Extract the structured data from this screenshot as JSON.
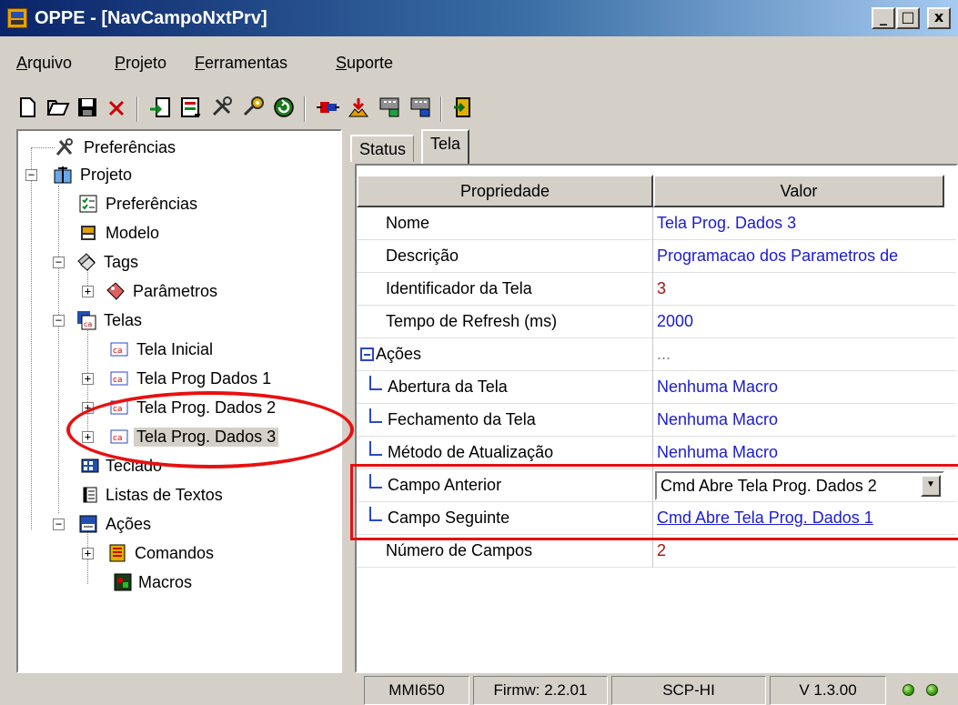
{
  "window": {
    "title": "OPPE - [NavCampoNxtPrv]",
    "buttons": {
      "minimize": "_",
      "maximize": "□",
      "close": "x"
    }
  },
  "menu": {
    "items": [
      {
        "first": "A",
        "rest": "rquivo"
      },
      {
        "first": "P",
        "rest": "rojeto"
      },
      {
        "first": "F",
        "rest": "erramentas"
      },
      {
        "first": "S",
        "rest": "uporte"
      }
    ]
  },
  "toolbar": {
    "icons": [
      "new-file-icon",
      "open-folder-icon",
      "save-icon",
      "delete-icon",
      "import-icon",
      "export-icon",
      "tools-icon",
      "settings-icon",
      "refresh-icon",
      "transfer-icon",
      "send-icon",
      "download-icon",
      "upload-icon",
      "exit-icon"
    ]
  },
  "tree": {
    "items": [
      {
        "label": "Preferências"
      },
      {
        "label": "Projeto"
      },
      {
        "label": "Preferências"
      },
      {
        "label": "Modelo"
      },
      {
        "label": "Tags"
      },
      {
        "label": "Parâmetros"
      },
      {
        "label": "Telas"
      },
      {
        "label": "Tela Inicial"
      },
      {
        "label": "Tela Prog Dados 1"
      },
      {
        "label": "Tela Prog. Dados 2"
      },
      {
        "label": "Tela Prog. Dados 3"
      },
      {
        "label": "Teclado"
      },
      {
        "label": "Listas de Textos"
      },
      {
        "label": "Ações"
      },
      {
        "label": "Comandos"
      },
      {
        "label": "Macros"
      }
    ]
  },
  "tabs": {
    "status": "Status",
    "tela": "Tela"
  },
  "grid": {
    "headers": {
      "prop": "Propriedade",
      "val": "Valor"
    },
    "rows": [
      {
        "prop": "Nome",
        "val": "Tela Prog. Dados 3"
      },
      {
        "prop": "Descrição",
        "val": "Programacao dos Parametros de"
      },
      {
        "prop": "Identificador da Tela",
        "val": "3"
      },
      {
        "prop": "Tempo de Refresh (ms)",
        "val": "2000"
      },
      {
        "prop": "Ações",
        "val": "..."
      },
      {
        "prop": "Abertura da Tela",
        "val": "Nenhuma Macro"
      },
      {
        "prop": "Fechamento da Tela",
        "val": "Nenhuma Macro"
      },
      {
        "prop": "Método de Atualização",
        "val": "Nenhuma Macro"
      },
      {
        "prop": "Campo Anterior",
        "val": "Cmd Abre Tela Prog. Dados 2"
      },
      {
        "prop": "Campo Seguinte",
        "val": "Cmd Abre Tela Prog. Dados 1"
      },
      {
        "prop": "Número de Campos",
        "val": "2"
      }
    ]
  },
  "status": {
    "model": "MMI650",
    "firmware": "Firmw: 2.2.01",
    "protocol": "SCP-HI",
    "version": "V 1.3.00"
  },
  "colors": {
    "annotation": "#e81010",
    "value_blue": "#1b1bd6",
    "value_red": "#b01010"
  }
}
